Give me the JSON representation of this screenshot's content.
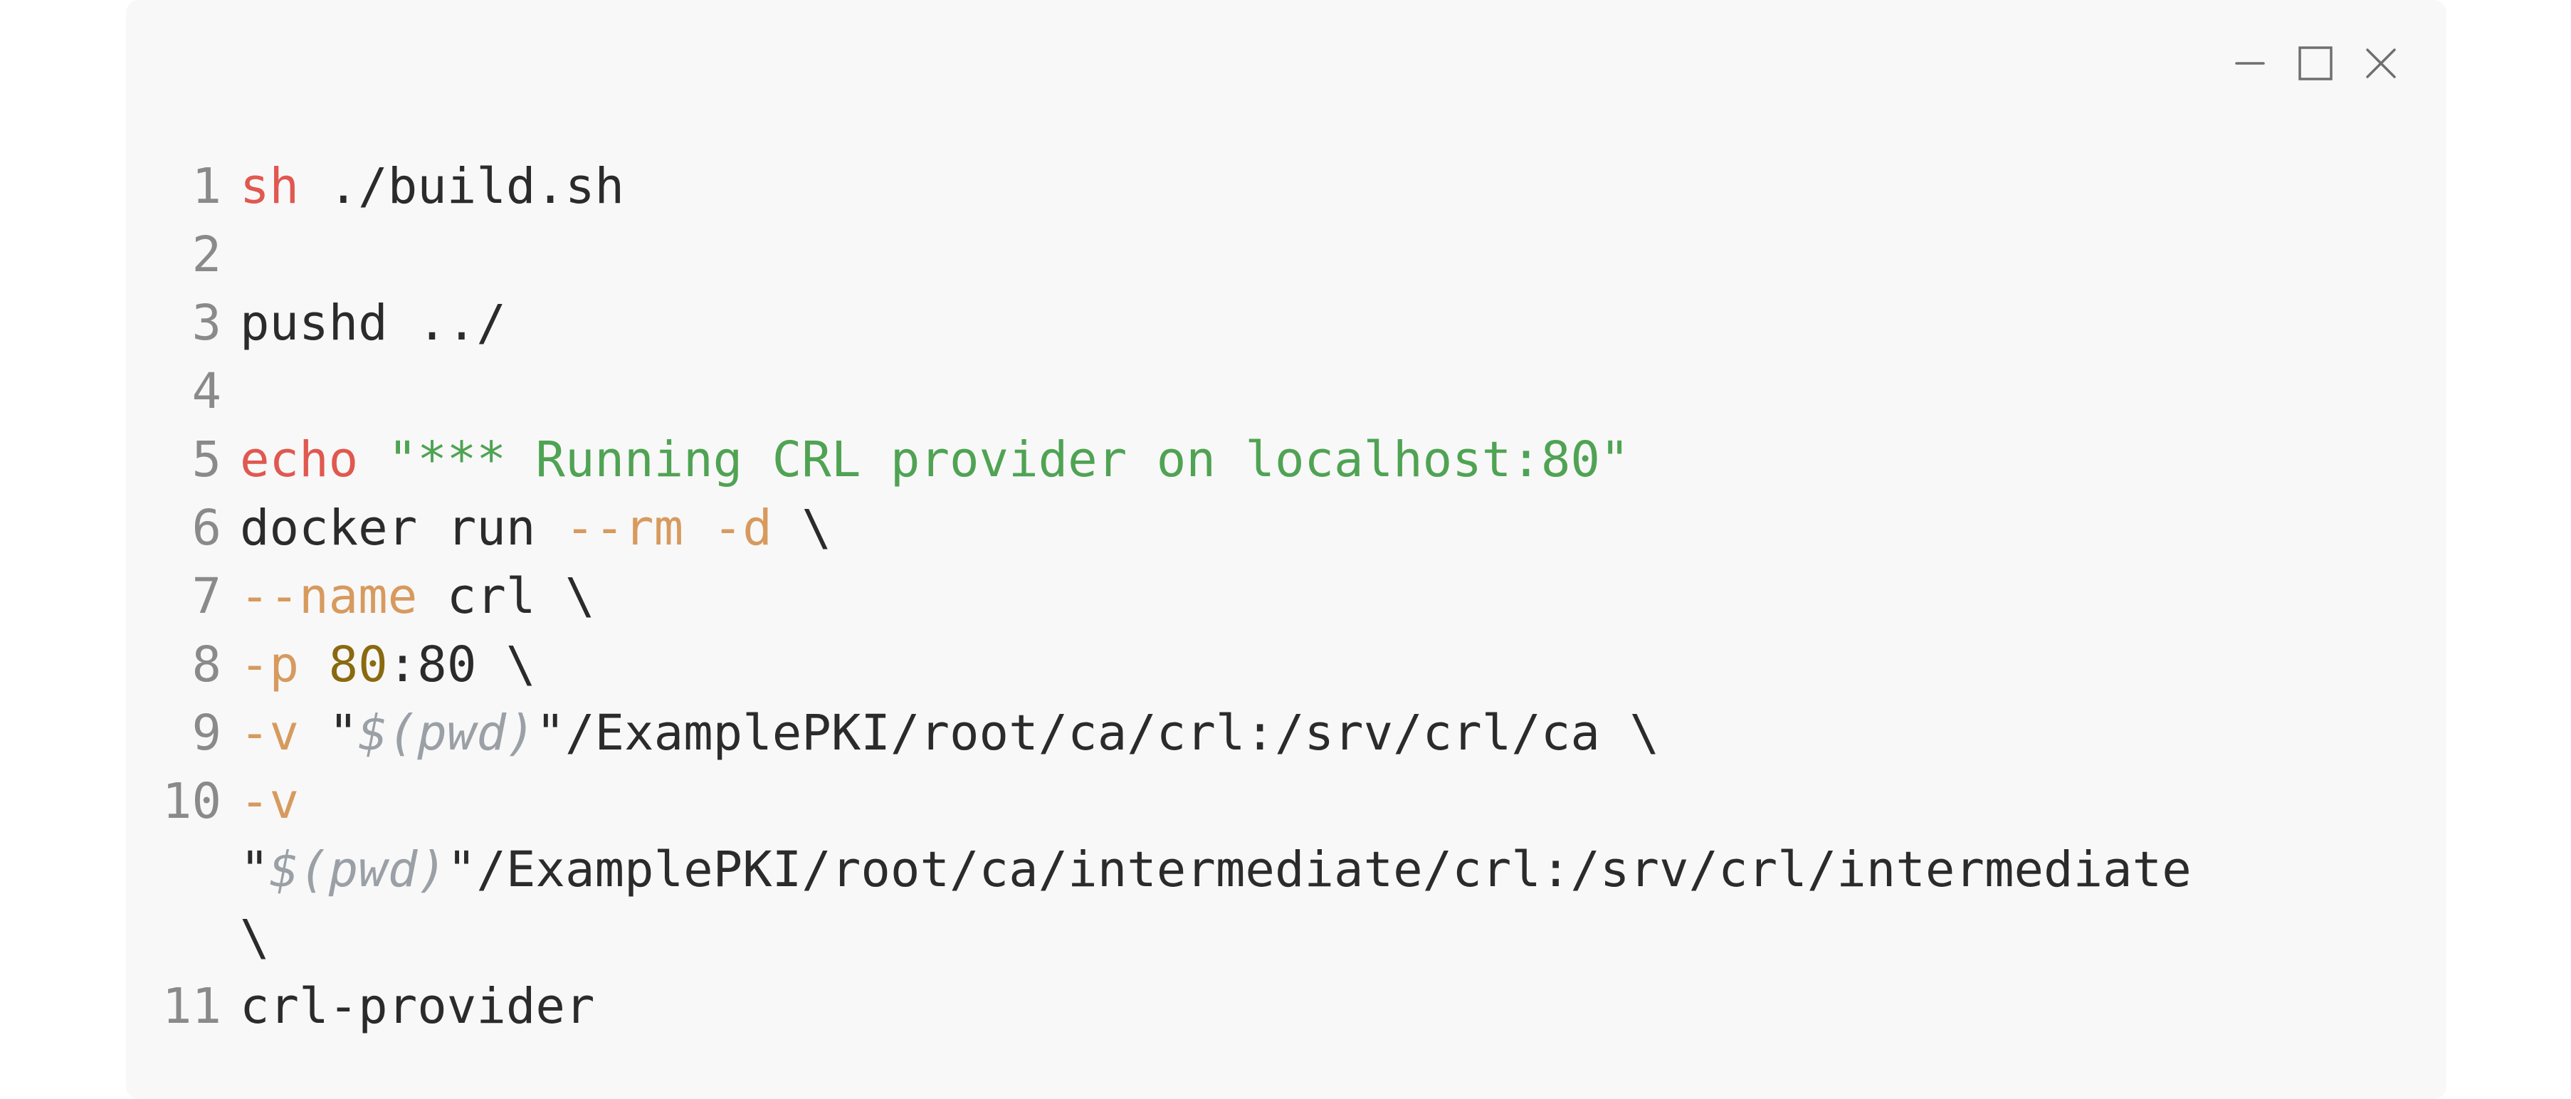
{
  "window": {
    "controls": {
      "minimize_icon": "minimize-icon",
      "maximize_icon": "maximize-icon",
      "close_icon": "close-icon"
    }
  },
  "code": {
    "lines": [
      {
        "number": "1",
        "tokens": [
          {
            "t": "kw",
            "v": "sh"
          },
          {
            "t": "plain",
            "v": " ./build.sh"
          }
        ]
      },
      {
        "number": "2",
        "tokens": []
      },
      {
        "number": "3",
        "tokens": [
          {
            "t": "plain",
            "v": "pushd ../"
          }
        ]
      },
      {
        "number": "4",
        "tokens": []
      },
      {
        "number": "5",
        "tokens": [
          {
            "t": "kw",
            "v": "echo"
          },
          {
            "t": "plain",
            "v": " "
          },
          {
            "t": "str",
            "v": "\"*** Running CRL provider on localhost:80\""
          }
        ]
      },
      {
        "number": "6",
        "tokens": [
          {
            "t": "plain",
            "v": "docker run "
          },
          {
            "t": "flag",
            "v": "--rm"
          },
          {
            "t": "plain",
            "v": " "
          },
          {
            "t": "flag",
            "v": "-d"
          },
          {
            "t": "plain",
            "v": " \\"
          }
        ]
      },
      {
        "number": "7",
        "tokens": [
          {
            "t": "flag",
            "v": "--name"
          },
          {
            "t": "plain",
            "v": " crl \\"
          }
        ]
      },
      {
        "number": "8",
        "tokens": [
          {
            "t": "flag",
            "v": "-p"
          },
          {
            "t": "plain",
            "v": " "
          },
          {
            "t": "num",
            "v": "80"
          },
          {
            "t": "plain",
            "v": ":80 \\"
          }
        ]
      },
      {
        "number": "9",
        "tokens": [
          {
            "t": "flag",
            "v": "-v"
          },
          {
            "t": "plain",
            "v": " \""
          },
          {
            "t": "var",
            "v": "$(pwd)"
          },
          {
            "t": "plain",
            "v": "\"/ExamplePKI/root/ca/crl:/srv/crl/ca \\"
          }
        ]
      },
      {
        "number": "10",
        "tokens": [
          {
            "t": "flag",
            "v": "-v"
          },
          {
            "t": "plain",
            "v": "\n\""
          },
          {
            "t": "var",
            "v": "$(pwd)"
          },
          {
            "t": "plain",
            "v": "\"/ExamplePKI/root/ca/intermediate/crl:/srv/crl/intermediate\n\\"
          }
        ]
      },
      {
        "number": "11",
        "tokens": [
          {
            "t": "plain",
            "v": "crl-provider"
          }
        ]
      }
    ]
  }
}
